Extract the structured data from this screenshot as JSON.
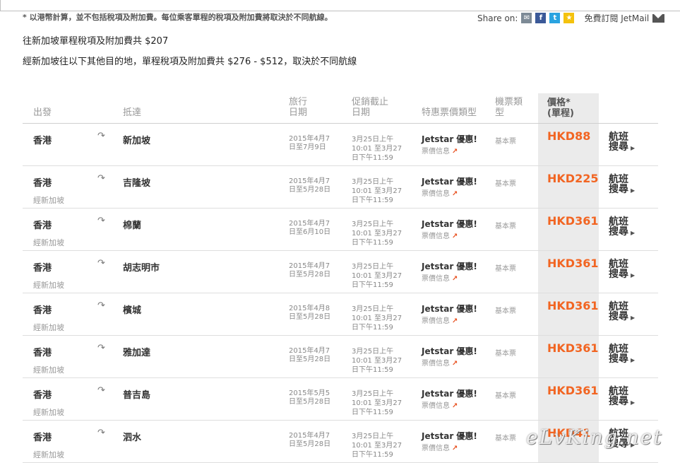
{
  "note": "* 以港幣計算，並不包括稅項及附加費。每位乘客單程的稅項及附加費將取決於不同航線。",
  "share": {
    "label": "Share on:",
    "jetmail": "免費訂閱 JetMail",
    "icons": [
      "mail-icon",
      "facebook-icon",
      "twitter-icon",
      "star-icon"
    ]
  },
  "tax_line1": "往新加坡單程稅項及附加費共 $207",
  "tax_line2": "經新加坡往以下其他目的地，單程稅項及附加費共 $276 - $512，取決於不同航線",
  "headers": {
    "from": "出發",
    "to": "抵達",
    "travel_1": "旅行",
    "travel_2": "日期",
    "promo_1": "促銷截止",
    "promo_2": "日期",
    "deal": "特惠票價類型",
    "type_1": "機票類",
    "type_2": "型",
    "price_1": "價格*",
    "price_2": "(單程)"
  },
  "rows": [
    {
      "from": "香港",
      "via": "",
      "to": "新加坡",
      "t1": "2015年4月7",
      "t2": "日至7月9日",
      "p1": "3月25日上午",
      "p2": "10:01 至3月27",
      "p3": "日下午11:59",
      "deal": "Jetstar 優惠!",
      "deal_sub": "票價信息",
      "type": "基本票",
      "price": "HKD88",
      "search_1": "航班",
      "search_2": "搜尋"
    },
    {
      "from": "香港",
      "via": "經新加坡",
      "to": "吉隆坡",
      "t1": "2015年4月7",
      "t2": "日至5月28日",
      "p1": "3月25日上午",
      "p2": "10:01 至3月27",
      "p3": "日下午11:59",
      "deal": "Jetstar 優惠!",
      "deal_sub": "票價信息",
      "type": "基本票",
      "price": "HKD225",
      "search_1": "航班",
      "search_2": "搜尋"
    },
    {
      "from": "香港",
      "via": "經新加坡",
      "to": "棉蘭",
      "t1": "2015年4月7",
      "t2": "日至6月10日",
      "p1": "3月25日上午",
      "p2": "10:01 至3月27",
      "p3": "日下午11:59",
      "deal": "Jetstar 優惠!",
      "deal_sub": "票價信息",
      "type": "基本票",
      "price": "HKD361",
      "search_1": "航班",
      "search_2": "搜尋"
    },
    {
      "from": "香港",
      "via": "經新加坡",
      "to": "胡志明市",
      "t1": "2015年4月7",
      "t2": "日至5月28日",
      "p1": "3月25日上午",
      "p2": "10:01 至3月27",
      "p3": "日下午11:59",
      "deal": "Jetstar 優惠!",
      "deal_sub": "票價信息",
      "type": "基本票",
      "price": "HKD361",
      "search_1": "航班",
      "search_2": "搜尋"
    },
    {
      "from": "香港",
      "via": "經新加坡",
      "to": "檳城",
      "t1": "2015年4月8",
      "t2": "日至5月28日",
      "p1": "3月25日上午",
      "p2": "10:01 至3月27",
      "p3": "日下午11:59",
      "deal": "Jetstar 優惠!",
      "deal_sub": "票價信息",
      "type": "基本票",
      "price": "HKD361",
      "search_1": "航班",
      "search_2": "搜尋"
    },
    {
      "from": "香港",
      "via": "經新加坡",
      "to": "雅加達",
      "t1": "2015年4月7",
      "t2": "日至5月28日",
      "p1": "3月25日上午",
      "p2": "10:01 至3月27",
      "p3": "日下午11:59",
      "deal": "Jetstar 優惠!",
      "deal_sub": "票價信息",
      "type": "基本票",
      "price": "HKD361",
      "search_1": "航班",
      "search_2": "搜尋"
    },
    {
      "from": "香港",
      "via": "經新加坡",
      "to": "普吉島",
      "t1": "2015年5月5",
      "t2": "日至5月28日",
      "p1": "3月25日上午",
      "p2": "10:01 至3月27",
      "p3": "日下午11:59",
      "deal": "Jetstar 優惠!",
      "deal_sub": "票價信息",
      "type": "基本票",
      "price": "HKD361",
      "search_1": "航班",
      "search_2": "搜尋"
    },
    {
      "from": "香港",
      "via": "經新加坡",
      "to": "泗水",
      "t1": "2015年4月7",
      "t2": "日至5月28日",
      "p1": "3月25日上午",
      "p2": "10:01 至3月27",
      "p3": "日下午11:59",
      "deal": "Jetstar 優惠!",
      "deal_sub": "票價信息",
      "type": "基本票",
      "price": "HKD41",
      "search_1": "航班",
      "search_2": "搜尋"
    }
  ],
  "watermark": "eLvKing.net",
  "colors": {
    "price": "#f26522",
    "price_column_bg": "#ebebeb"
  }
}
